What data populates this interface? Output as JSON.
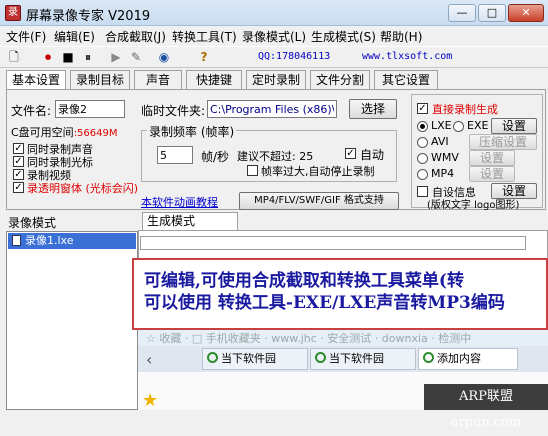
{
  "window": {
    "title": "屏幕录像专家 V2019",
    "app_icon_glyph": "录",
    "min": "—",
    "max": "□",
    "close": "✕"
  },
  "menu": [
    "文件(F)",
    "编辑(E)",
    "合成截取(J)",
    "转换工具(T)",
    "录像模式(L)",
    "生成模式(S)",
    "帮助(H)"
  ],
  "toolbar": {
    "icons": [
      "new-file-icon",
      "record-icon",
      "stop-icon",
      "pause-icon",
      "playback-icon",
      "camera-icon",
      "globe-icon",
      "help-icon"
    ],
    "glyphs": [
      "🗋",
      "⏺",
      "■",
      "⏸",
      "▶",
      "✎",
      "◉",
      "?"
    ],
    "qq": "QQ:178046113",
    "website": "www.tlxsoft.com"
  },
  "tabs": [
    "基本设置",
    "录制目标",
    "声音",
    "快捷键",
    "定时录制",
    "文件分割",
    "其它设置"
  ],
  "settings": {
    "filename_label": "文件名:",
    "filename_value": "录像2",
    "tempfolder_label": "临时文件夹:",
    "tempfolder_value": "C:\\Program Files (x86)\\",
    "choose_button": "选择",
    "disk_space_label": "C盘可用空间",
    "disk_space_value": ":56649M",
    "checks": [
      {
        "label": "同时录制声音",
        "checked": true
      },
      {
        "label": "同时录制光标",
        "checked": true
      },
      {
        "label": "录制视频",
        "checked": true
      },
      {
        "label": "录透明窗体 (光标会闪)",
        "checked": true,
        "color": "#e00000"
      }
    ],
    "rate_group_title": "录制频率 (帧率)",
    "fps_value": "5",
    "fps_unit": "帧/秒",
    "max_hint": "建议不超过: 25",
    "auto_label": "自动",
    "auto_checked": true,
    "auto_stop_label": "帧率过大,自动停止录制",
    "auto_stop_checked": false,
    "tutorial_link": "本软件动画教程",
    "format_button": "MP4/FLV/SWF/GIF  格式支持"
  },
  "output": {
    "direct_label": "直接录制生成",
    "direct_checked": true,
    "formats": [
      {
        "label": "LXE",
        "selected": true
      },
      {
        "label": "EXE",
        "selected": false
      },
      {
        "label": "AVI",
        "selected": false
      },
      {
        "label": "WMV",
        "selected": false
      },
      {
        "label": "MP4",
        "selected": false
      }
    ],
    "settings_btn": "设置",
    "compress_btn": "压缩设置",
    "custom_info_label": "自设信息",
    "custom_info_btn": "设置",
    "copyright_text": "(版权文字 logo图形)"
  },
  "lower": {
    "list_label": "录像模式",
    "list_items": [
      "录像1.lxe"
    ],
    "gen_tab": "生成模式",
    "big_text_line1": "可编辑,可使用合成截取和转换工具菜单(转",
    "big_text_line2": "可以使用  转换工具-EXE/LXE声音转MP3编码"
  },
  "browser": {
    "bookmarks_faded": "☆ 收藏 ·  □ 手机收藏夹  ·  www.jhc  ·  安全测试  ·  downxia  ·  检测中",
    "back": "‹",
    "tabs": [
      "当下软件园",
      "当下软件园",
      "添加内容"
    ],
    "watermark": "ARP联盟 arpun.com"
  }
}
